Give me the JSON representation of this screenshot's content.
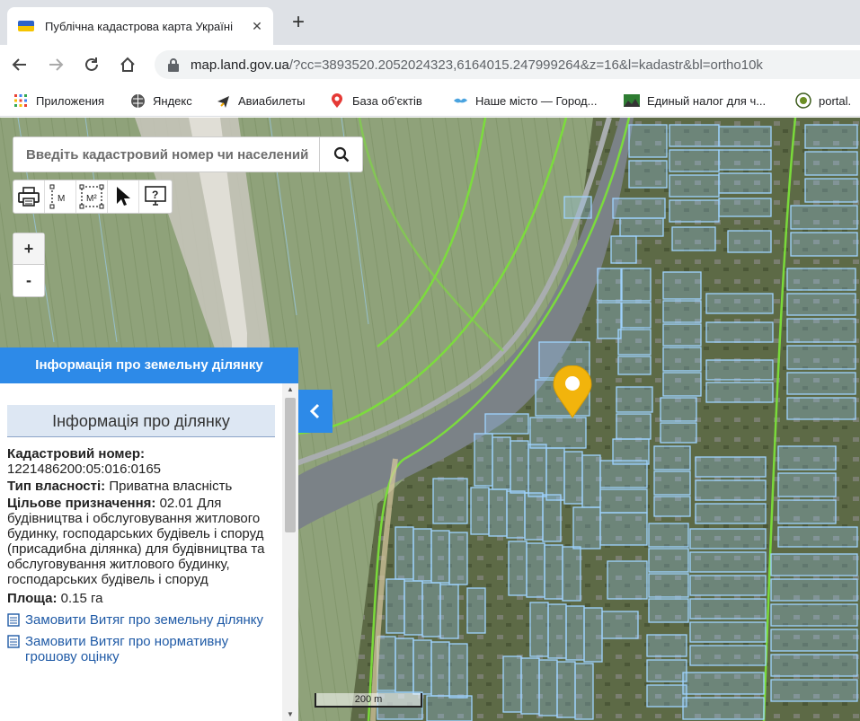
{
  "browser": {
    "tab_title": "Публічна кадастрова карта Україні",
    "url_host": "map.land.gov.ua",
    "url_path": "/?cc=3893520.2052024323,6164015.247999264&z=16&l=kadastr&bl=ortho10k",
    "bookmarks": [
      {
        "label": "Приложения",
        "icon": "apps-grid-icon"
      },
      {
        "label": "Яндекс",
        "icon": "globe-icon"
      },
      {
        "label": "Авиабилеты",
        "icon": "airplane-icon"
      },
      {
        "label": "База об'єктів",
        "icon": "map-pin-icon"
      },
      {
        "label": "Наше місто — Город...",
        "icon": "bird-icon"
      },
      {
        "label": "Единый налог для ч...",
        "icon": "landscape-icon"
      },
      {
        "label": "portal.",
        "icon": "emblem-icon"
      }
    ]
  },
  "map": {
    "search_placeholder": "Введіть кадастровий номер чи населений",
    "zoom_in": "+",
    "zoom_out": "-",
    "tool_measure_length": "M",
    "tool_measure_area": "M²",
    "scale_label": "200 m",
    "colors": {
      "parcel": "#8ec5ff",
      "boundary": "#7be03a",
      "marker": "#f2b40c",
      "accent": "#2d8ae8"
    }
  },
  "panel": {
    "header": "Інформація про земельну ділянку",
    "section_title": "Інформація про ділянку",
    "fields": [
      {
        "label": "Кадастровий номер:",
        "value": "1221486200:05:016:0165"
      },
      {
        "label": "Тип власності:",
        "value": "Приватна власність"
      },
      {
        "label": "Цільове призначення:",
        "value": "02.01 Для будівництва і обслуговування житлового будинку, господарських будівель і споруд (присадибна ділянка) для будівництва та обслуговування житлового будинку, господарських будівель і споруд"
      },
      {
        "label": "Площа:",
        "value": "0.15 га"
      }
    ],
    "links": [
      "Замовити Витяг про земельну ділянку",
      "Замовити Витяг про нормативну грошову оцінку"
    ]
  }
}
